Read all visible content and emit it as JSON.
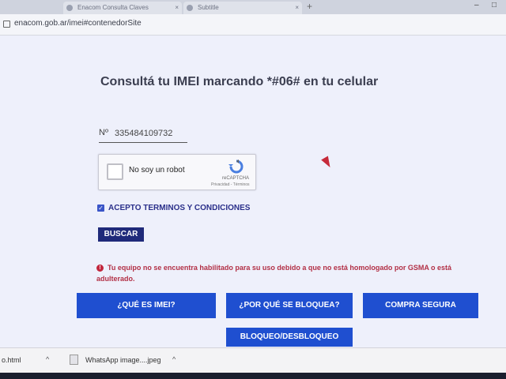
{
  "browser": {
    "tabs": [
      {
        "label": "Enacom Consulta Claves"
      },
      {
        "label": "Subtitle"
      }
    ],
    "new_tab_symbol": "+",
    "close_symbol": "×",
    "window_controls": [
      "–",
      "□"
    ],
    "url": "enacom.gob.ar/imei#contenedorSite"
  },
  "page": {
    "title": "Consultá tu IMEI marcando *#06# en tu celular",
    "imei_label": "Nº",
    "imei_value": "335484109732",
    "captcha": {
      "label": "No soy un robot",
      "brand": "reCAPTCHA",
      "links": "Privacidad - Términos"
    },
    "terms_label": "ACEPTO TERMINOS Y CONDICIONES",
    "terms_checked": true,
    "search_button": "BUSCAR",
    "error_message": "Tu equipo no se encuentra habilitado para su uso debido a que no está homologado por GSMA o está adulterado.",
    "error_icon": "!",
    "buttons": {
      "que_es_imei": "¿QUÉ ES IMEI?",
      "por_que_bloquea": "¿POR QUÉ SE BLOQUEA?",
      "compra_segura": "COMPRA SEGURA",
      "bloqueo": "BLOQUEO/DESBLOQUEO"
    }
  },
  "downloads": {
    "item1": "o.html",
    "item2": "WhatsApp image....jpeg",
    "chevron": "^"
  },
  "colors": {
    "primary_button": "#1f4fd0",
    "dark_button": "#1f2a7a",
    "error": "#b23046"
  }
}
